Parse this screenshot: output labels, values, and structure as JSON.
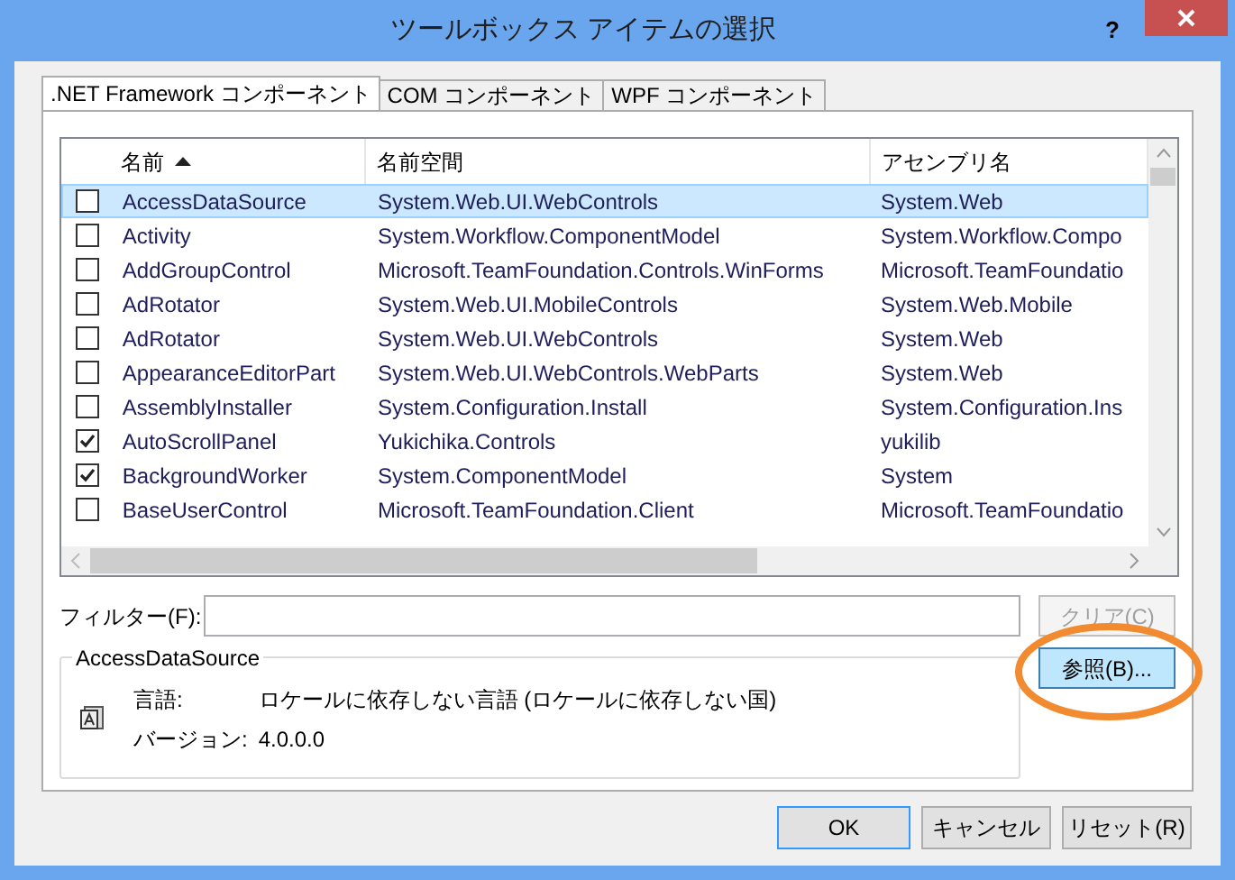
{
  "window": {
    "title": "ツールボックス アイテムの選択",
    "help": "?"
  },
  "tabs": [
    {
      "label": ".NET Framework コンポーネント",
      "selected": true
    },
    {
      "label": "COM コンポーネント",
      "selected": false
    },
    {
      "label": "WPF コンポーネント",
      "selected": false
    }
  ],
  "table": {
    "columns": [
      {
        "label": "名前",
        "sorted": true
      },
      {
        "label": "名前空間",
        "sorted": false
      },
      {
        "label": "アセンブリ名",
        "sorted": false
      }
    ],
    "rows": [
      {
        "checked": false,
        "selected": true,
        "name": "AccessDataSource",
        "namespace": "System.Web.UI.WebControls",
        "assembly": "System.Web"
      },
      {
        "checked": false,
        "selected": false,
        "name": "Activity",
        "namespace": "System.Workflow.ComponentModel",
        "assembly": "System.Workflow.Compo"
      },
      {
        "checked": false,
        "selected": false,
        "name": "AddGroupControl",
        "namespace": "Microsoft.TeamFoundation.Controls.WinForms",
        "assembly": "Microsoft.TeamFoundatio"
      },
      {
        "checked": false,
        "selected": false,
        "name": "AdRotator",
        "namespace": "System.Web.UI.MobileControls",
        "assembly": "System.Web.Mobile"
      },
      {
        "checked": false,
        "selected": false,
        "name": "AdRotator",
        "namespace": "System.Web.UI.WebControls",
        "assembly": "System.Web"
      },
      {
        "checked": false,
        "selected": false,
        "name": "AppearanceEditorPart",
        "namespace": "System.Web.UI.WebControls.WebParts",
        "assembly": "System.Web"
      },
      {
        "checked": false,
        "selected": false,
        "name": "AssemblyInstaller",
        "namespace": "System.Configuration.Install",
        "assembly": "System.Configuration.Ins"
      },
      {
        "checked": true,
        "selected": false,
        "name": "AutoScrollPanel",
        "namespace": "Yukichika.Controls",
        "assembly": "yukilib"
      },
      {
        "checked": true,
        "selected": false,
        "name": "BackgroundWorker",
        "namespace": "System.ComponentModel",
        "assembly": "System"
      },
      {
        "checked": false,
        "selected": false,
        "name": "BaseUserControl",
        "namespace": "Microsoft.TeamFoundation.Client",
        "assembly": "Microsoft.TeamFoundatio"
      }
    ]
  },
  "filter": {
    "label": "フィルター(F):",
    "clear_button": "クリア(C)",
    "clear_disabled": true
  },
  "details": {
    "title": "AccessDataSource",
    "language_label": "言語:",
    "language": "ロケールに依存しない言語 (ロケールに依存しない国)",
    "version_label": "バージョン:",
    "version": "4.0.0.0"
  },
  "browse_button": "参照(B)...",
  "buttons": [
    {
      "label": "OK",
      "default": true
    },
    {
      "label": "キャンセル",
      "default": false
    },
    {
      "label": "リセット(R)",
      "default": false
    }
  ]
}
